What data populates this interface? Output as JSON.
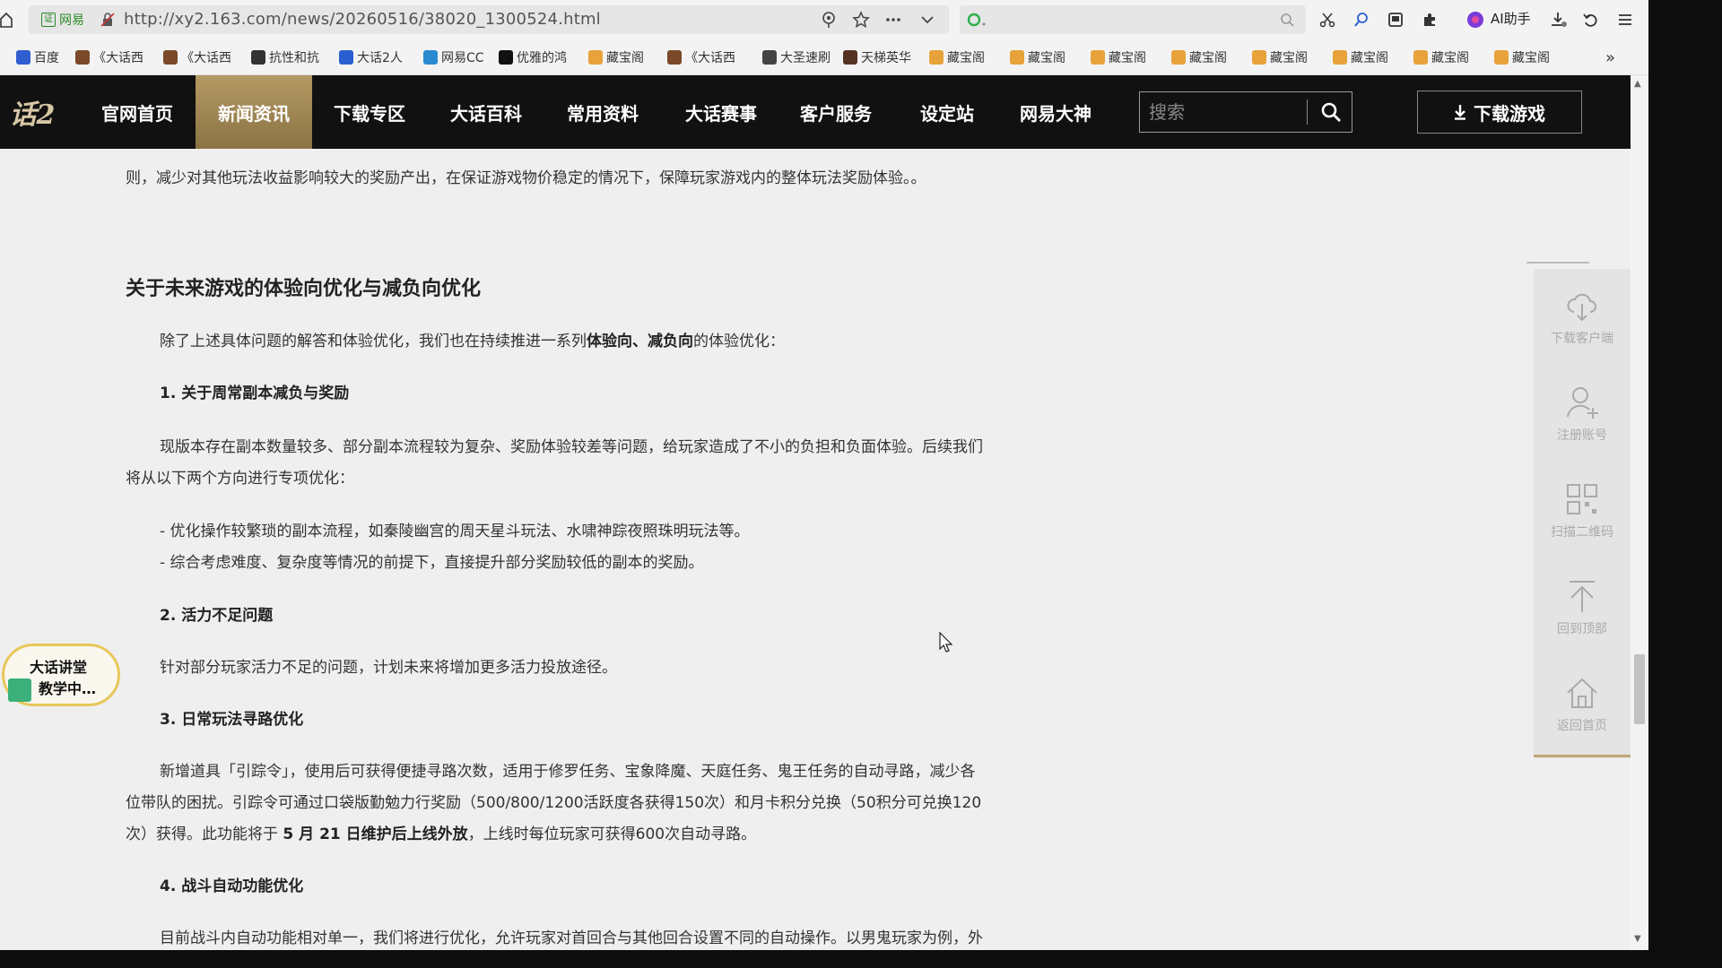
{
  "browser": {
    "site_chip": "网易",
    "url": "http://xy2.163.com/news/20260516/38020_1300524.html",
    "ai_assistant": "AI助手",
    "bookmarks": [
      {
        "label": "百度",
        "color": "#2f5fd0"
      },
      {
        "label": "《大话西",
        "color": "#7a4a2a"
      },
      {
        "label": "《大话西",
        "color": "#7a4a2a"
      },
      {
        "label": "抗性和抗",
        "color": "#333333"
      },
      {
        "label": "大话2人",
        "color": "#2a5fd0"
      },
      {
        "label": "网易CC",
        "color": "#2a8ad0"
      },
      {
        "label": "优雅的鸿",
        "color": "#111111"
      },
      {
        "label": "藏宝阁",
        "color": "#e8a23a"
      },
      {
        "label": "《大话西",
        "color": "#7a4a2a"
      },
      {
        "label": "大圣速刷",
        "color": "#444444"
      },
      {
        "label": "天梯英华",
        "color": "#553322"
      },
      {
        "label": "藏宝阁",
        "color": "#e8a23a"
      },
      {
        "label": "藏宝阁",
        "color": "#e8a23a"
      },
      {
        "label": "藏宝阁",
        "color": "#e8a23a"
      },
      {
        "label": "藏宝阁",
        "color": "#e8a23a"
      },
      {
        "label": "藏宝阁",
        "color": "#e8a23a"
      },
      {
        "label": "藏宝阁",
        "color": "#e8a23a"
      },
      {
        "label": "藏宝阁",
        "color": "#e8a23a"
      },
      {
        "label": "藏宝阁",
        "color": "#e8a23a"
      }
    ]
  },
  "nav": {
    "logo": "话2",
    "items": [
      "官网首页",
      "新闻资讯",
      "下载专区",
      "大话百科",
      "常用资料",
      "大话赛事",
      "客户服务",
      "设定站",
      "网易大神"
    ],
    "active_index": 1,
    "search_placeholder": "搜索",
    "download_label": "下载游戏",
    "accent_color": "#b49a63"
  },
  "article": {
    "prev_text": "则，减少对其他玩法收益影响较大的奖励产出，在保证游戏物价稳定的情况下，保障玩家游戏内的整体玩法奖励体验。。",
    "section_title": "关于未来游戏的体验向优化与减负向优化",
    "intro_a": "除了上述具体问题的解答和体验优化，我们也在持续推进一系列",
    "intro_b": "体验向、减负向",
    "intro_c": "的体验优化：",
    "s1_title": "1. 关于周常副本减负与奖励",
    "s1_p1": "现版本存在副本数量较多、部分副本流程较为复杂、奖励体验较差等问题，给玩家造成了不小的负担和负面体验。后续我们",
    "s1_p2": "将从以下两个方向进行专项优化：",
    "s1_b1": "- 优化操作较繁琐的副本流程，如秦陵幽宫的周天星斗玩法、水啸神踪夜照珠明玩法等。",
    "s1_b2": "- 综合考虑难度、复杂度等情况的前提下，直接提升部分奖励较低的副本的奖励。",
    "s2_title": "2. 活力不足问题",
    "s2_p1": "针对部分玩家活力不足的问题，计划未来将增加更多活力投放途径。",
    "s3_title": "3. 日常玩法寻路优化",
    "s3_p1": "新增道具「引踪令」，使用后可获得便捷寻路次数，适用于修罗任务、宝象降魔、天庭任务、鬼王任务的自动寻路，减少各",
    "s3_p2": "位带队的困扰。引踪令可通过口袋版勤勉力行奖励（500/800/1200活跃度各获得150次）和月卡积分兑换（50积分可兑换120",
    "s3_p3a": "次）获得。此功能将于 ",
    "s3_p3b": "5 月 21 日维护后上线外放",
    "s3_p3c": "，上线时每位玩家可获得600次自动寻路。",
    "s4_title": "4. 战斗自动功能优化",
    "s4_p1": "目前战斗内自动功能相对单一，我们将进行优化，允许玩家对首回合与其他回合设置不同的自动操作。以男鬼玩家为例，外"
  },
  "float_bar": {
    "items": [
      {
        "label": "下载客户端",
        "icon": "cloud-download-icon"
      },
      {
        "label": "注册账号",
        "icon": "user-add-icon"
      },
      {
        "label": "扫描二维码",
        "icon": "qrcode-icon"
      },
      {
        "label": "回到顶部",
        "icon": "back-to-top-icon"
      },
      {
        "label": "返回首页",
        "icon": "home-icon"
      }
    ]
  },
  "badge": {
    "line1": "大话讲堂",
    "line2": "教学中…"
  }
}
